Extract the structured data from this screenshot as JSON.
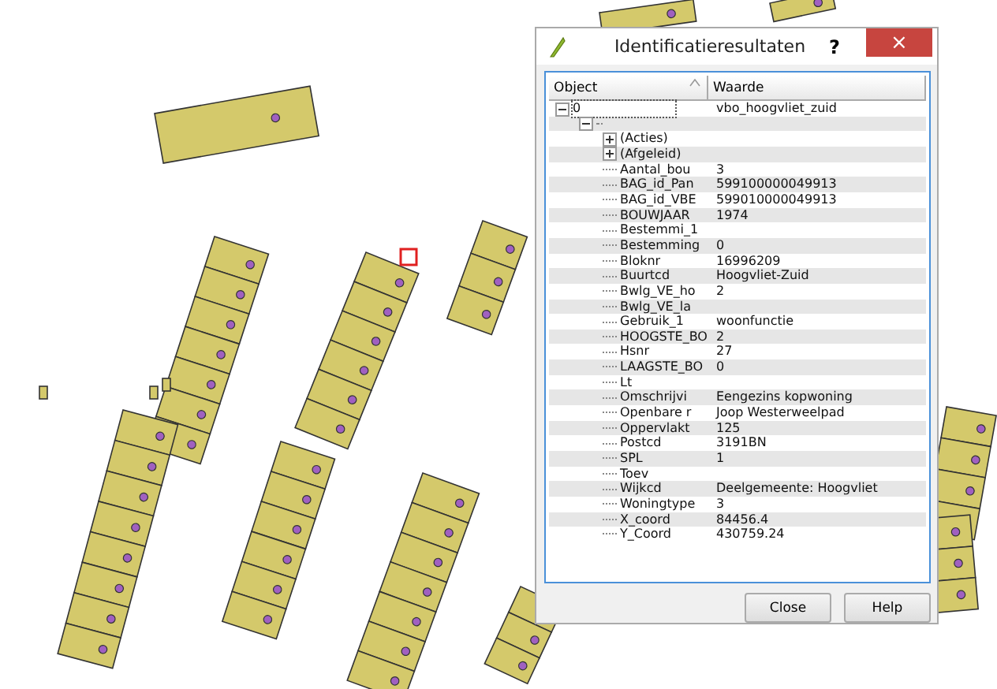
{
  "window": {
    "title": "Identificatieresultaten",
    "help": "?",
    "close": "×"
  },
  "table": {
    "columns": [
      "Object",
      "Waarde"
    ],
    "rows": [
      {
        "label": "0",
        "value": "vbo_hoogvliet_zuid",
        "expanded": true,
        "selected": true,
        "children": [
          {
            "expanded": true,
            "children": [
              {
                "label": "(Acties)",
                "expanded": false
              },
              {
                "label": "(Afgeleid)",
                "expanded": false
              },
              {
                "label": "Aantal_bou",
                "value": "3"
              },
              {
                "label": "BAG_id_Pan",
                "value": "599100000049913"
              },
              {
                "label": "BAG_id_VBE",
                "value": "599010000049913"
              },
              {
                "label": "BOUWJAAR",
                "value": "1974"
              },
              {
                "label": "Bestemmi_1"
              },
              {
                "label": "Bestemming",
                "value": "0"
              },
              {
                "label": "Bloknr",
                "value": "16996209"
              },
              {
                "label": "Buurtcd",
                "value": "Hoogvliet-Zuid"
              },
              {
                "label": "Bwlg_VE_ho",
                "value": "2"
              },
              {
                "label": "Bwlg_VE_la"
              },
              {
                "label": "Gebruik_1",
                "value": "woonfunctie"
              },
              {
                "label": "HOOGSTE_BO",
                "value": "2"
              },
              {
                "label": "Hsnr",
                "value": "27"
              },
              {
                "label": "LAAGSTE_BO",
                "value": "0"
              },
              {
                "label": "Lt"
              },
              {
                "label": "Omschrijvi",
                "value": "Eengezins kopwoning"
              },
              {
                "label": "Openbare r",
                "value": "Joop Westerweelpad"
              },
              {
                "label": "Oppervlakt",
                "value": "125"
              },
              {
                "label": "Postcd",
                "value": "3191BN"
              },
              {
                "label": "SPL",
                "value": "1"
              },
              {
                "label": "Toev"
              },
              {
                "label": "Wijkcd",
                "value": "Deelgemeente: Hoogvliet"
              },
              {
                "label": "Woningtype",
                "value": "3"
              },
              {
                "label": "X_coord",
                "value": "84456.4"
              },
              {
                "label": "Y_Coord",
                "value": "430759.24"
              }
            ]
          }
        ]
      }
    ]
  },
  "buttons": [
    "Close",
    "Help"
  ]
}
